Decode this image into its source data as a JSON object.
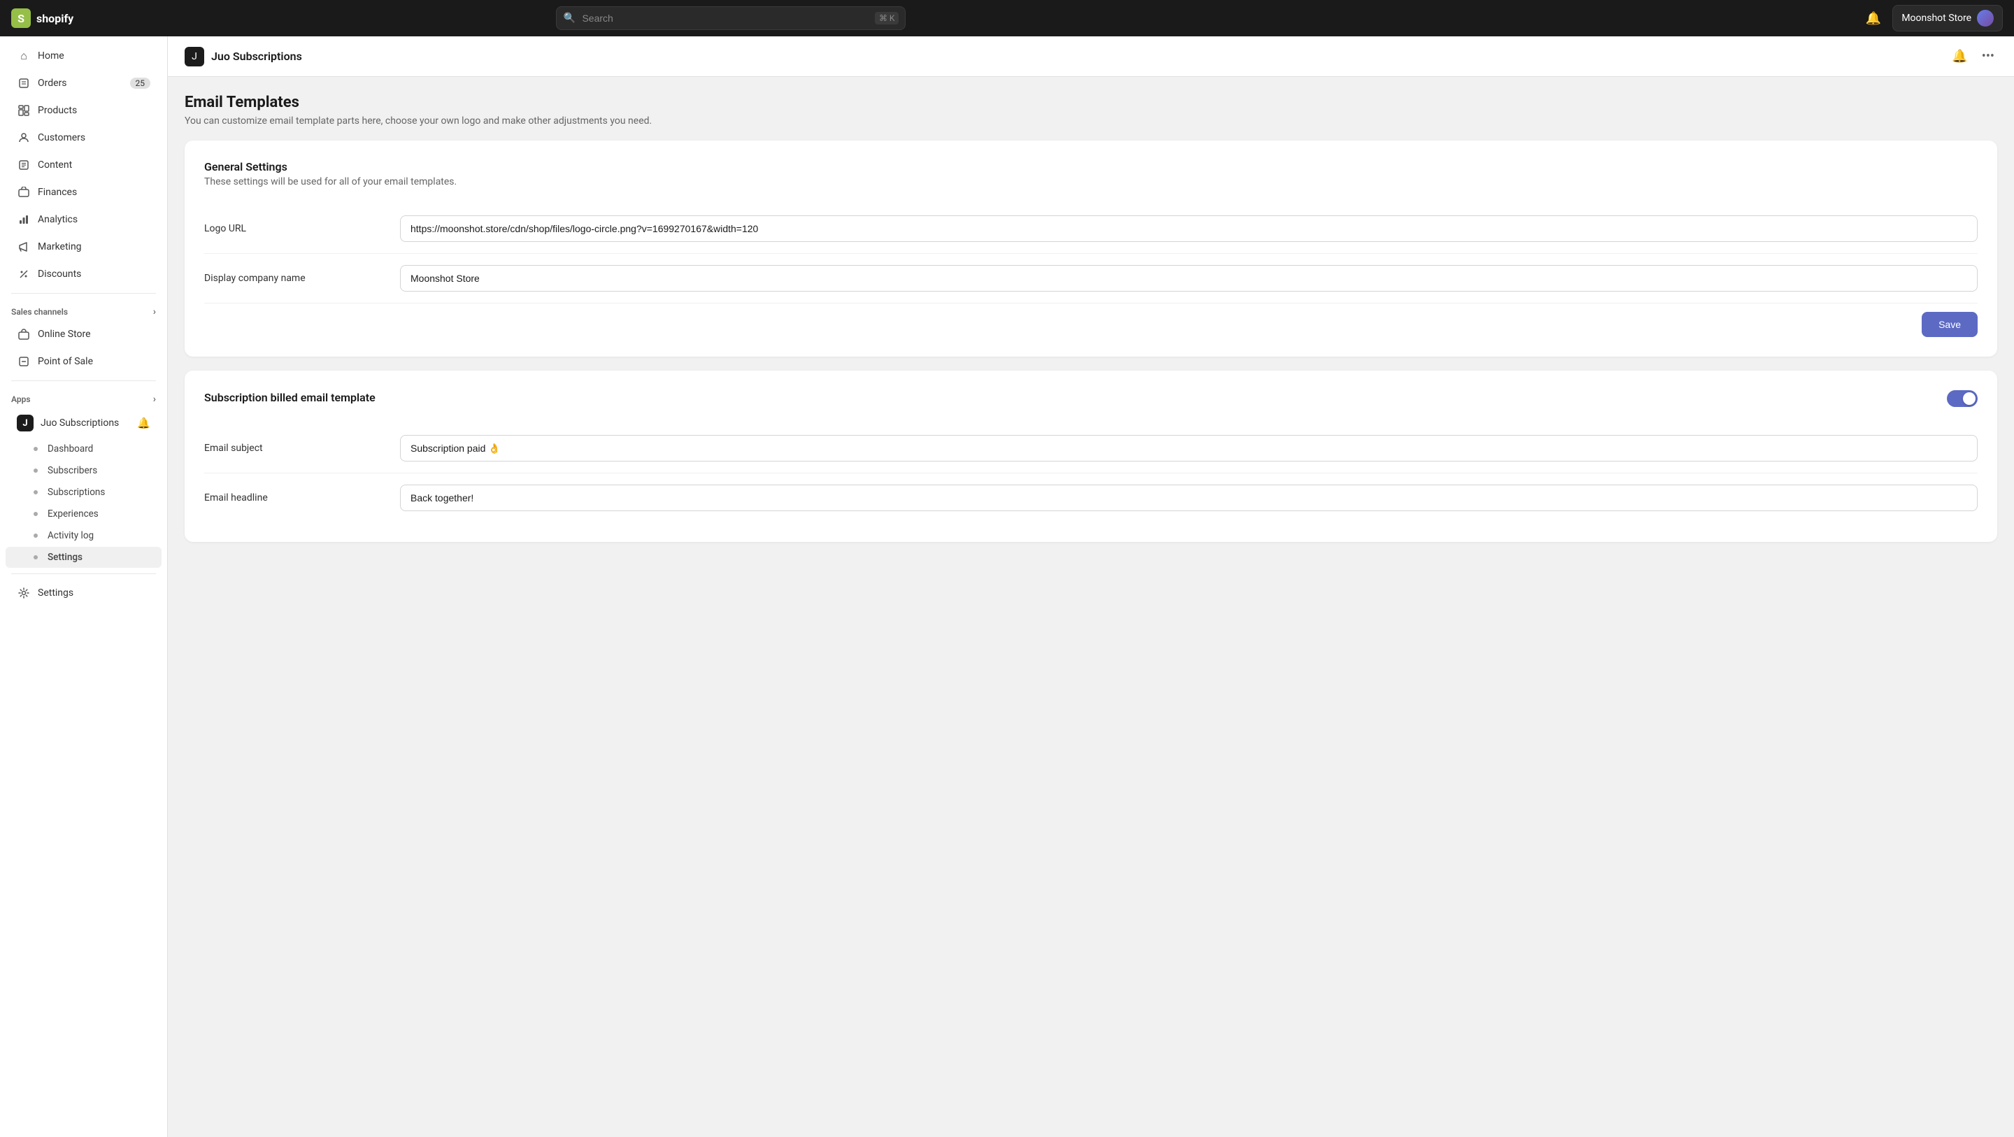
{
  "topnav": {
    "logo_text": "shopify",
    "search_placeholder": "Search",
    "search_shortcut": "⌘ K",
    "store_name": "Moonshot Store"
  },
  "sidebar": {
    "items": [
      {
        "id": "home",
        "label": "Home",
        "icon": "⌂",
        "badge": null
      },
      {
        "id": "orders",
        "label": "Orders",
        "icon": "📋",
        "badge": "25"
      },
      {
        "id": "products",
        "label": "Products",
        "icon": "📦",
        "badge": null
      },
      {
        "id": "customers",
        "label": "Customers",
        "icon": "👤",
        "badge": null
      },
      {
        "id": "content",
        "label": "Content",
        "icon": "📄",
        "badge": null
      },
      {
        "id": "finances",
        "label": "Finances",
        "icon": "🏦",
        "badge": null
      },
      {
        "id": "analytics",
        "label": "Analytics",
        "icon": "📊",
        "badge": null
      },
      {
        "id": "marketing",
        "label": "Marketing",
        "icon": "📣",
        "badge": null
      },
      {
        "id": "discounts",
        "label": "Discounts",
        "icon": "🏷",
        "badge": null
      }
    ],
    "sales_channels_label": "Sales channels",
    "sales_channels": [
      {
        "id": "online-store",
        "label": "Online Store",
        "icon": "🏪"
      },
      {
        "id": "pos",
        "label": "Point of Sale",
        "icon": "💳"
      }
    ],
    "apps_label": "Apps",
    "app_name": "Juo Subscriptions",
    "sub_items": [
      {
        "id": "dashboard",
        "label": "Dashboard"
      },
      {
        "id": "subscribers",
        "label": "Subscribers"
      },
      {
        "id": "subscriptions",
        "label": "Subscriptions"
      },
      {
        "id": "experiences",
        "label": "Experiences"
      },
      {
        "id": "activity-log",
        "label": "Activity log"
      },
      {
        "id": "settings",
        "label": "Settings"
      }
    ],
    "settings_label": "Settings"
  },
  "page": {
    "header_icon": "J",
    "header_title": "Juo Subscriptions",
    "main_title": "Email Templates",
    "main_subtitle": "You can customize email template parts here, choose your own logo and make other adjustments you need.",
    "general_settings": {
      "title": "General Settings",
      "subtitle": "These settings will be used for all of your email templates.",
      "logo_url_label": "Logo URL",
      "logo_url_value": "https://moonshot.store/cdn/shop/files/logo-circle.png?v=1699270167&width=120",
      "company_name_label": "Display company name",
      "company_name_value": "Moonshot Store",
      "save_label": "Save"
    },
    "subscription_billed": {
      "title": "Subscription billed email template",
      "toggle_on": true,
      "email_subject_label": "Email subject",
      "email_subject_value": "Subscription paid 👌",
      "email_headline_label": "Email headline",
      "email_headline_value": "Back together!"
    }
  }
}
